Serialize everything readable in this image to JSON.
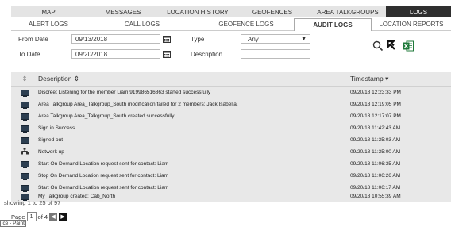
{
  "top_tabs": [
    "MAP",
    "MESSAGES",
    "LOCATION HISTORY",
    "GEOFENCES",
    "AREA TALKGROUPS",
    "LOGS"
  ],
  "sub_tabs": [
    "ALERT LOGS",
    "CALL LOGS",
    "GEOFENCE LOGS",
    "AUDIT LOGS",
    "LOCATION REPORTS"
  ],
  "filters": {
    "from_date_label": "From Date",
    "from_date_value": "09/13/2018",
    "to_date_label": "To Date",
    "to_date_value": "09/20/2018",
    "type_label": "Type",
    "type_value": "Any",
    "description_label": "Description",
    "description_value": ""
  },
  "table": {
    "headers": {
      "sort_icon": "⇕",
      "description": "Description ⇕",
      "timestamp": "Timestamp ▾"
    },
    "rows": [
      {
        "icon": "computer-icon",
        "description": "Discreet Listening for the member Liam 919986516863 started successfully",
        "timestamp": "09/20/18 12:23:33 PM"
      },
      {
        "icon": "computer-icon",
        "description": "Area Talkgroup Area_Talkgroup_South modification failed for 2 members: Jack,Isabella,",
        "timestamp": "09/20/18 12:19:05 PM"
      },
      {
        "icon": "computer-icon",
        "description": "Area Talkgroup Area_Talkgroup_South created successfully",
        "timestamp": "09/20/18 12:17:07 PM"
      },
      {
        "icon": "computer-icon",
        "description": "Sign in Success",
        "timestamp": "09/20/18 11:42:43 AM"
      },
      {
        "icon": "computer-icon",
        "description": "Signed out",
        "timestamp": "09/20/18 11:35:03 AM"
      },
      {
        "icon": "network-icon",
        "description": "Network up",
        "timestamp": "09/20/18 11:35:00 AM"
      },
      {
        "icon": "computer-icon",
        "description": "Start On Demand Location request sent for contact: Liam",
        "timestamp": "09/20/18 11:06:35 AM"
      },
      {
        "icon": "computer-icon",
        "description": "Stop On Demand Location request sent for contact: Liam",
        "timestamp": "09/20/18 11:06:26 AM"
      },
      {
        "icon": "computer-icon",
        "description": "Start On Demand Location request sent for contact: Liam",
        "timestamp": "09/20/18 11:06:17 AM"
      },
      {
        "icon": "computer-icon",
        "description": "My Talkgroup created: Cab_North",
        "timestamp": "09/20/18 10:55:39 AM"
      }
    ]
  },
  "footer": {
    "showing": "showing 1 to 25 of 97",
    "page_label": "Page",
    "page_value": "1",
    "of_label": "of 4",
    "prev": "◀",
    "next": "▶",
    "tooltip": "ice - Paint"
  },
  "colors": {
    "active_tab_bg": "#2f2f2f",
    "grid_bg": "#e8e8e8",
    "excel_green": "#1f7a3a"
  }
}
